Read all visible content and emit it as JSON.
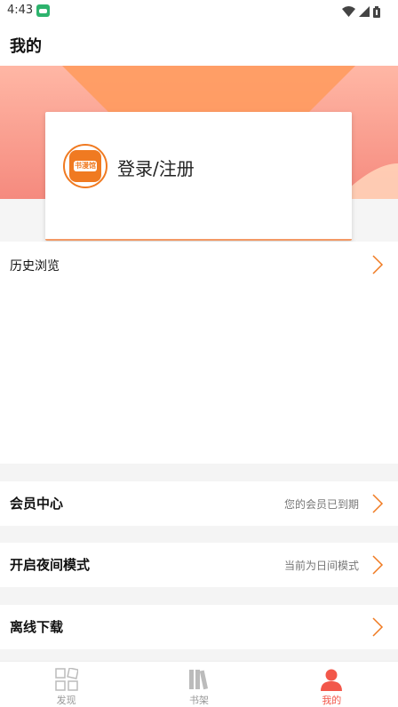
{
  "status": {
    "time": "4:43"
  },
  "header": {
    "title": "我的"
  },
  "account": {
    "login_label": "登录/注册",
    "logo_text": "书漫馆"
  },
  "menu": {
    "history": {
      "label": "历史浏览"
    },
    "member": {
      "label": "会员中心",
      "status": "您的会员已到期"
    },
    "night_mode": {
      "label": "开启夜间模式",
      "status": "当前为日间模式"
    },
    "offline": {
      "label": "离线下载"
    }
  },
  "tabs": [
    {
      "label": "发现",
      "icon": "grid-icon",
      "active": false
    },
    {
      "label": "书架",
      "icon": "books-icon",
      "active": false
    },
    {
      "label": "我的",
      "icon": "person-icon",
      "active": true
    }
  ],
  "colors": {
    "accent": "#f07a21",
    "active_tab": "#f2574a",
    "hero_top": "#ffb7a5",
    "hero_bottom": "#f58a7e"
  }
}
